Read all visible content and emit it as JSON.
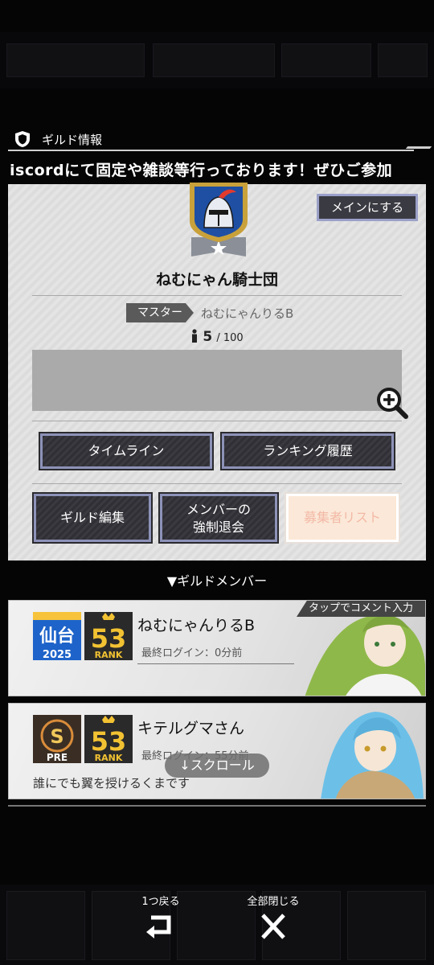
{
  "header": {
    "title": "ギルド情報",
    "ticker": "iscordにて固定や雑談等行っております！ぜひご参加"
  },
  "guild": {
    "make_main_label": "メインにする",
    "name": "ねむにゃん騎士団",
    "master_label": "マスター",
    "master_name": "ねむにゃんりるB",
    "member_count": "5",
    "member_max": "/ 100",
    "buttons": {
      "timeline": "タイムライン",
      "ranking_history": "ランキング履歴",
      "edit": "ギルド編集",
      "kick_line1": "メンバーの",
      "kick_line2": "強制退会",
      "applicants": "募集者リスト"
    }
  },
  "members": {
    "heading": "▼ギルドメンバー",
    "tap_hint": "タップでコメント入力",
    "list": [
      {
        "name": "ねむにゃんりるB",
        "login": "最終ログイン：0分前",
        "comment": "",
        "badge1_top": "仙台",
        "badge1_bottom": "2025",
        "rank_num": "53",
        "rank_label": "RANK"
      },
      {
        "name": "キテルグマさん",
        "login": "最終ログイン：55分前",
        "comment": "誰にでも翼を授けるくまです",
        "badge1_top": "S",
        "badge1_bottom": "PRE",
        "rank_num": "53",
        "rank_label": "RANK"
      }
    ],
    "scroll_hint": "↓スクロール"
  },
  "nav": {
    "back_label": "1つ戻る",
    "close_all_label": "全部閉じる"
  },
  "colors": {
    "accent_border": "#8d92b8",
    "emblem_blue": "#1e4fa3",
    "emblem_gold": "#c9a13a",
    "rank_gold": "#f2c232"
  }
}
